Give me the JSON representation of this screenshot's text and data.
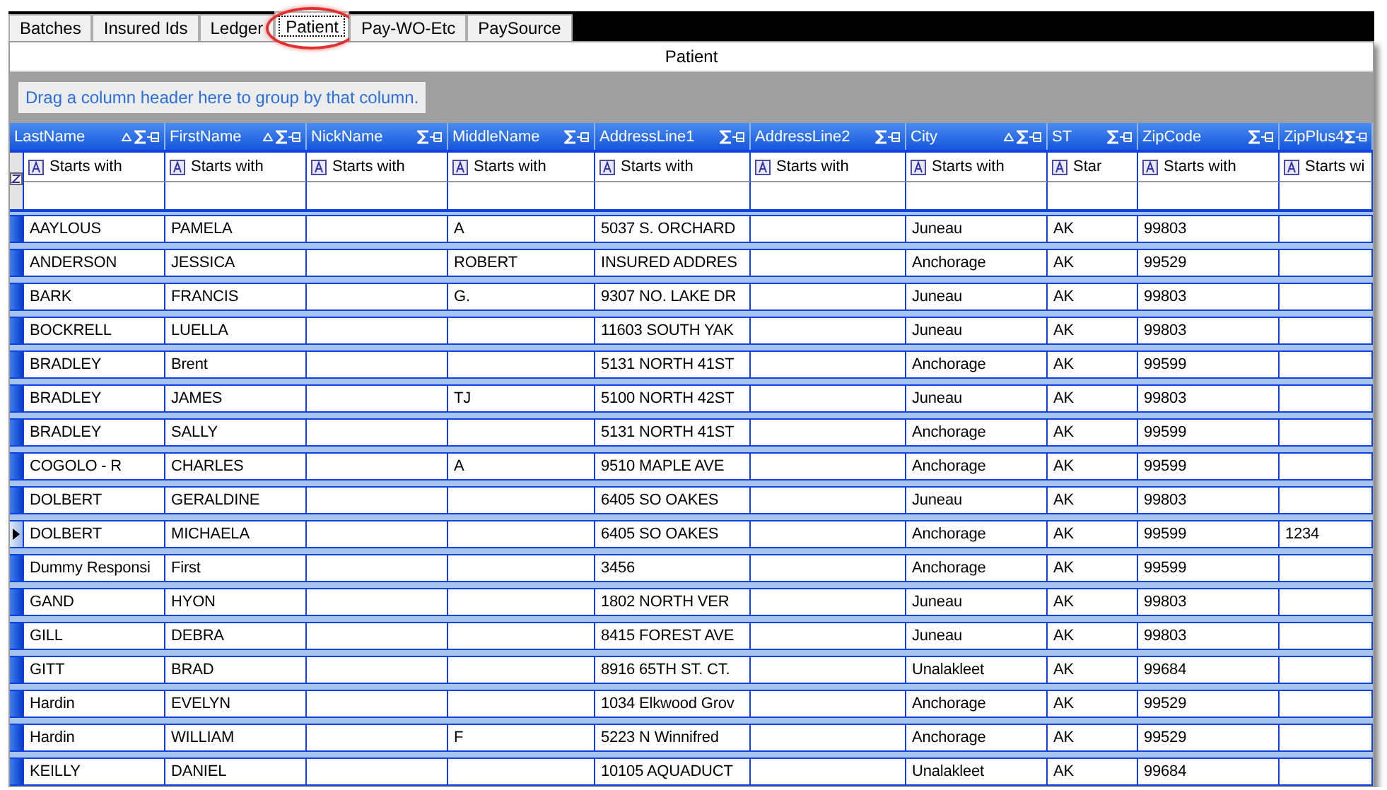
{
  "tabs": [
    {
      "label": "Batches",
      "selected": false,
      "circled": false
    },
    {
      "label": "Insured Ids",
      "selected": false,
      "circled": false
    },
    {
      "label": "Ledger",
      "selected": false,
      "circled": false
    },
    {
      "label": "Patient",
      "selected": true,
      "circled": true
    },
    {
      "label": "Pay-WO-Etc",
      "selected": false,
      "circled": false
    },
    {
      "label": "PaySource",
      "selected": false,
      "circled": false
    }
  ],
  "grid_title": "Patient",
  "group_hint": "Drag a column header here to group by that column.",
  "columns": [
    {
      "header": "LastName",
      "sorted": true,
      "filter_operator": "Starts with"
    },
    {
      "header": "FirstName",
      "sorted": true,
      "filter_operator": "Starts with"
    },
    {
      "header": "NickName",
      "sorted": false,
      "filter_operator": "Starts with"
    },
    {
      "header": "MiddleName",
      "sorted": false,
      "filter_operator": "Starts with"
    },
    {
      "header": "AddressLine1",
      "sorted": false,
      "filter_operator": "Starts with"
    },
    {
      "header": "AddressLine2",
      "sorted": false,
      "filter_operator": "Starts with"
    },
    {
      "header": "City",
      "sorted": true,
      "filter_operator": "Starts with"
    },
    {
      "header": "ST",
      "sorted": false,
      "filter_operator": "Star"
    },
    {
      "header": "ZipCode",
      "sorted": false,
      "filter_operator": "Starts with"
    },
    {
      "header": "ZipPlus4",
      "sorted": false,
      "filter_operator": "Starts wi"
    }
  ],
  "rows": [
    {
      "current": false,
      "cells": [
        "AAYLOUS",
        "PAMELA",
        "",
        "A",
        "5037 S. ORCHARD",
        "",
        "Juneau",
        "AK",
        "99803",
        ""
      ]
    },
    {
      "current": false,
      "cells": [
        "ANDERSON",
        "JESSICA",
        "",
        "ROBERT",
        "INSURED ADDRES",
        "",
        "Anchorage",
        "AK",
        "99529",
        ""
      ]
    },
    {
      "current": false,
      "cells": [
        "BARK",
        "FRANCIS",
        "",
        "G.",
        "9307 NO. LAKE DR",
        "",
        "Juneau",
        "AK",
        "99803",
        ""
      ]
    },
    {
      "current": false,
      "cells": [
        "BOCKRELL",
        "LUELLA",
        "",
        "",
        "11603 SOUTH YAK",
        "",
        "Juneau",
        "AK",
        "99803",
        ""
      ]
    },
    {
      "current": false,
      "cells": [
        "BRADLEY",
        "Brent",
        "",
        "",
        "5131 NORTH 41ST",
        "",
        "Anchorage",
        "AK",
        "99599",
        ""
      ]
    },
    {
      "current": false,
      "cells": [
        "BRADLEY",
        "JAMES",
        "",
        "TJ",
        "5100 NORTH 42ST",
        "",
        "Juneau",
        "AK",
        "99803",
        ""
      ]
    },
    {
      "current": false,
      "cells": [
        "BRADLEY",
        "SALLY",
        "",
        "",
        "5131 NORTH 41ST",
        "",
        "Anchorage",
        "AK",
        "99599",
        ""
      ]
    },
    {
      "current": false,
      "cells": [
        "COGOLO - R",
        "CHARLES",
        "",
        "A",
        "9510 MAPLE AVE",
        "",
        "Anchorage",
        "AK",
        "99599",
        ""
      ]
    },
    {
      "current": false,
      "cells": [
        "DOLBERT",
        "GERALDINE",
        "",
        "",
        "6405 SO OAKES",
        "",
        "Juneau",
        "AK",
        "99803",
        ""
      ]
    },
    {
      "current": true,
      "cells": [
        "DOLBERT",
        "MICHAELA",
        "",
        "",
        "6405 SO OAKES",
        "",
        "Anchorage",
        "AK",
        "99599",
        "1234"
      ]
    },
    {
      "current": false,
      "cells": [
        "Dummy Responsi",
        "First",
        "",
        "",
        "3456",
        "",
        "Anchorage",
        "AK",
        "99599",
        ""
      ]
    },
    {
      "current": false,
      "cells": [
        "GAND",
        "HYON",
        "",
        "",
        "1802 NORTH VER",
        "",
        "Juneau",
        "AK",
        "99803",
        ""
      ]
    },
    {
      "current": false,
      "cells": [
        "GILL",
        "DEBRA",
        "",
        "",
        "8415 FOREST AVE",
        "",
        "Juneau",
        "AK",
        "99803",
        ""
      ]
    },
    {
      "current": false,
      "cells": [
        "GITT",
        "BRAD",
        "",
        "",
        "8916 65TH ST. CT.",
        "",
        "Unalakleet",
        "AK",
        "99684",
        ""
      ]
    },
    {
      "current": false,
      "cells": [
        "Hardin",
        "EVELYN",
        "",
        "",
        "1034 Elkwood Grov",
        "",
        "Anchorage",
        "AK",
        "99529",
        ""
      ]
    },
    {
      "current": false,
      "cells": [
        "Hardin",
        "WILLIAM",
        "",
        "F",
        "5223 N Winnifred",
        "",
        "Anchorage",
        "AK",
        "99529",
        ""
      ]
    },
    {
      "current": false,
      "cells": [
        "KEILLY",
        "DANIEL",
        "",
        "",
        "10105 AQUADUCT",
        "",
        "Unalakleet",
        "AK",
        "99684",
        ""
      ]
    }
  ]
}
